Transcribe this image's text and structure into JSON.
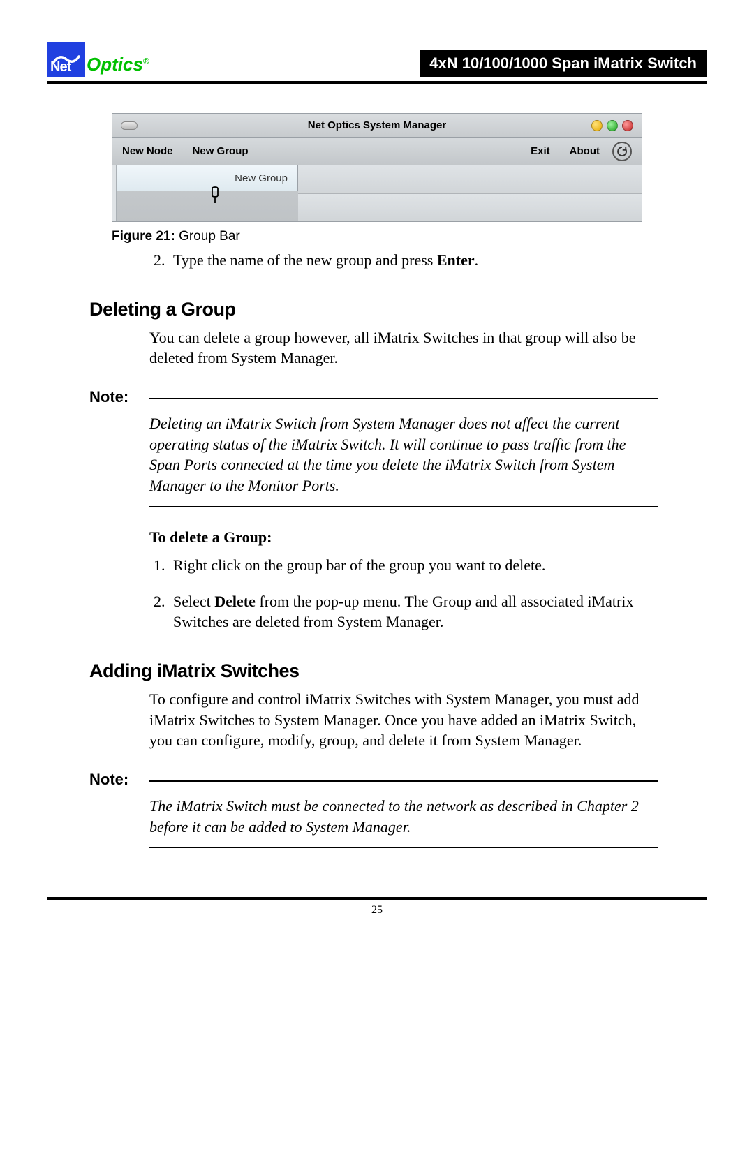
{
  "logo": {
    "net": "Net",
    "optics": "Optics",
    "reg": "®"
  },
  "title": "4xN 10/100/1000 Span iMatrix Switch",
  "screenshot": {
    "title": "Net Optics System Manager",
    "toolbar": {
      "new_node": "New Node",
      "new_group": "New Group",
      "exit": "Exit",
      "about": "About"
    },
    "groupbar_text": "New Group"
  },
  "figure_caption_prefix": "Figure 21: ",
  "figure_caption": "Group Bar",
  "step2_pre": "Type the name of the new group and press ",
  "step2_bold": "Enter",
  "step2_post": ".",
  "sec_delete_heading": "Deleting a Group",
  "sec_delete_intro": "You can delete a group however, all iMatrix Switches in that group will also be deleted from System Manager.",
  "note_label": "Note:",
  "note1_body": "Deleting an iMatrix Switch from System Manager does not affect the current operating status of the iMatrix Switch. It will continue to pass traffic from the Span Ports connected at the time you delete the iMatrix Switch from System Manager to the Monitor Ports.",
  "delete_steps_heading": "To delete a Group:",
  "delete_step1": "Right click on the group bar of the group you want to delete.",
  "delete_step2_pre": "Select ",
  "delete_step2_bold": "Delete",
  "delete_step2_post": " from the pop-up menu. The Group and all associated iMatrix Switches are deleted from System Manager.",
  "sec_add_heading": "Adding iMatrix Switches",
  "sec_add_intro": "To configure and control iMatrix Switches with System Manager, you must add iMatrix Switches to System Manager. Once you have added an iMatrix Switch, you can configure, modify, group, and delete it from System Manager.",
  "note2_body": "The iMatrix Switch must be connected to the network as described in Chapter 2 before it can be added to System Manager.",
  "page_num": "25"
}
